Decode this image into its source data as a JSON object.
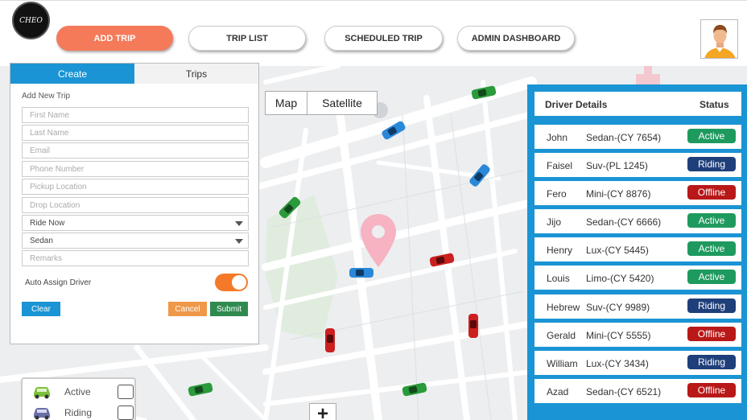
{
  "header": {
    "logo_text": "CHEO",
    "nav": [
      {
        "label": "ADD TRIP",
        "active": true
      },
      {
        "label": "TRIP LIST",
        "active": false
      },
      {
        "label": "SCHEDULED TRIP",
        "active": false
      },
      {
        "label": "ADMIN DASHBOARD",
        "active": false
      }
    ],
    "avatar_icon": "user-avatar-icon"
  },
  "map": {
    "type_options": [
      "Map",
      "Satellite"
    ],
    "zoom_in_label": "+",
    "pin_icon": "location-pin-icon"
  },
  "create_panel": {
    "tabs": [
      {
        "label": "Create",
        "active": true
      },
      {
        "label": "Trips",
        "active": false
      }
    ],
    "form_title": "Add New Trip",
    "fields": [
      {
        "placeholder": "First Name",
        "type": "text"
      },
      {
        "placeholder": "Last Name",
        "type": "text"
      },
      {
        "placeholder": "Email",
        "type": "text"
      },
      {
        "placeholder": "Phone Number",
        "type": "text"
      },
      {
        "placeholder": "Pickup Location",
        "type": "text"
      },
      {
        "placeholder": "Drop Location",
        "type": "text"
      },
      {
        "value": "Ride Now",
        "type": "select"
      },
      {
        "value": "Sedan",
        "type": "select"
      },
      {
        "placeholder": "Remarks",
        "type": "text"
      }
    ],
    "auto_assign_label": "Auto Assign Driver",
    "auto_assign_on": true,
    "buttons": {
      "clear": "Clear",
      "cancel": "Cancel",
      "submit": "Submit"
    }
  },
  "legend": {
    "items": [
      {
        "label": "Active",
        "color": "#3ba03b",
        "checked": false
      },
      {
        "label": "Riding",
        "color": "#6a6fa8",
        "checked": false
      }
    ]
  },
  "drivers": {
    "header_name": "Driver Details",
    "header_status": "Status",
    "rows": [
      {
        "name": "John",
        "car": "Sedan-(CY 7654)",
        "status": "Active"
      },
      {
        "name": "Faisel",
        "car": "Suv-(PL 1245)",
        "status": "Riding"
      },
      {
        "name": "Fero",
        "car": "Mini-(CY 8876)",
        "status": "Offline"
      },
      {
        "name": "Jijo",
        "car": "Sedan-(CY 6666)",
        "status": "Active"
      },
      {
        "name": "Henry",
        "car": "Lux-(CY 5445)",
        "status": "Active"
      },
      {
        "name": "Louis",
        "car": "Limo-(CY 5420)",
        "status": "Active"
      },
      {
        "name": "Hebrew",
        "car": "Suv-(CY 9989)",
        "status": "Riding"
      },
      {
        "name": "Gerald",
        "car": "Mini-(CY 5555)",
        "status": "Offline"
      },
      {
        "name": "William",
        "car": "Lux-(CY 3434)",
        "status": "Riding"
      },
      {
        "name": "Azad",
        "car": "Sedan-(CY 6521)",
        "status": "Offline"
      }
    ],
    "status_colors": {
      "Active": "#1f9a5f",
      "Riding": "#1f3f7a",
      "Offline": "#b81818"
    }
  },
  "colors": {
    "accent_blue": "#1a94d4",
    "accent_orange": "#f47a5a",
    "cancel_orange": "#f0984a",
    "submit_green": "#2f8a4f"
  }
}
